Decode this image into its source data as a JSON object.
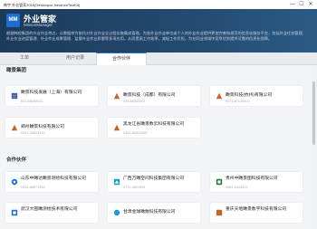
{
  "window": {
    "title": "韩宇 外业管家2016(Deskcapor AdvanceTestKit)",
    "minimize": "—",
    "maximize": "☐",
    "close": "✕"
  },
  "header": {
    "logo_text": "MM",
    "app_name": "外业管家",
    "app_sub": "MissonManager",
    "description": "根据韩程集团的外业作业特点，以数据库为依托对外业作业全过程实施集成管理。为各外业作业单位或个人的外业作业提供更加完善和规范的信息化服务平台，包括外业任务管理、外业作业进度管理、外业作业成果管理、监督外业作业质量等多项应用。从而提高工作效率，减轻工作负担，为在同业领域中竞争优势提供可靠的信息化保障。"
  },
  "tabs": [
    {
      "label": "工单"
    },
    {
      "label": "用户记录"
    },
    {
      "label": "合作伙伴"
    }
  ],
  "sections": {
    "group": {
      "title": "瞰景集团",
      "cards": [
        {
          "name": "瞰景科技发展（上海）有限公司",
          "phone": "021-68252021"
        },
        {
          "name": "瞰景科技（成都）有限公司",
          "phone": "028-86283201"
        },
        {
          "name": "瞰景科技(杭州)有限公司",
          "phone": "0571-87140001"
        },
        {
          "name": "郑州瞰景科技有限公司",
          "phone": "0371-56623170"
        },
        {
          "name": "黑龙江省瞰景数云科技有限公司",
          "phone": "0451-84621090"
        }
      ]
    },
    "partners": {
      "title": "合作伙伴",
      "cards": [
        {
          "name": "山东中瞰达瞰景测绘科技有限公司",
          "phone": "0531-88971333"
        },
        {
          "name": "广西万瞰空间科技集团有限公司",
          "phone": "0771-5821991"
        },
        {
          "name": "贵州中瞰景图科技有限公司",
          "phone": "0851-8444611"
        },
        {
          "name": "武汉大图瞰测绘技术有限公司",
          "phone": ""
        },
        {
          "name": "甘肃金球瞰数科技有限公司",
          "phone": ""
        },
        {
          "name": "重庆天地瞰景数字科技有限公司",
          "phone": ""
        }
      ]
    }
  },
  "colors": {
    "header_bg": "#234a70",
    "accent": "#2d6ad4",
    "icon_primary": "#c1662f",
    "icon_secondary": "#1f6fd1"
  }
}
